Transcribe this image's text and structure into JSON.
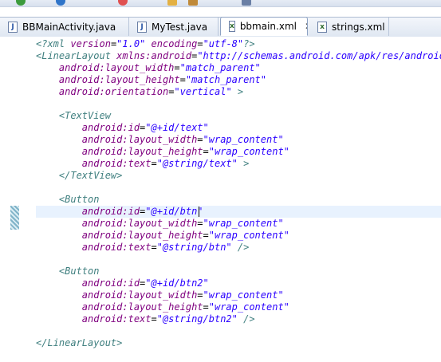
{
  "tabs": [
    {
      "label": "BBMainActivity.java",
      "icon": "java-file-icon",
      "active": false
    },
    {
      "label": "MyTest.java",
      "icon": "java-file-icon",
      "active": false
    },
    {
      "label": "bbmain.xml",
      "icon": "xml-file-icon",
      "active": true,
      "close_glyph": "✕"
    },
    {
      "label": "strings.xml",
      "icon": "xml-file-icon",
      "active": false
    }
  ],
  "editor": {
    "lines": [
      [
        [
          "decl",
          "<?xml "
        ],
        [
          "attr",
          "version"
        ],
        [
          "tx",
          "="
        ],
        [
          "val",
          "\"1.0\""
        ],
        [
          "tx",
          " "
        ],
        [
          "attr",
          "encoding"
        ],
        [
          "tx",
          "="
        ],
        [
          "val",
          "\"utf-8\""
        ],
        [
          "decl",
          "?>"
        ]
      ],
      [
        [
          "tag",
          "<LinearLayout "
        ],
        [
          "attr",
          "xmlns:android"
        ],
        [
          "tx",
          "="
        ],
        [
          "val",
          "\"http://schemas.android.com/apk/res/android\""
        ]
      ],
      [
        [
          "tx",
          "    "
        ],
        [
          "attr",
          "android:layout_width"
        ],
        [
          "tx",
          "="
        ],
        [
          "val",
          "\"match_parent\""
        ]
      ],
      [
        [
          "tx",
          "    "
        ],
        [
          "attr",
          "android:layout_height"
        ],
        [
          "tx",
          "="
        ],
        [
          "val",
          "\"match_parent\""
        ]
      ],
      [
        [
          "tx",
          "    "
        ],
        [
          "attr",
          "android:orientation"
        ],
        [
          "tx",
          "="
        ],
        [
          "val",
          "\"vertical\""
        ],
        [
          "tag",
          " >"
        ]
      ],
      [],
      [
        [
          "tx",
          "    "
        ],
        [
          "tag",
          "<TextView"
        ]
      ],
      [
        [
          "tx",
          "        "
        ],
        [
          "attr",
          "android:id"
        ],
        [
          "tx",
          "="
        ],
        [
          "val",
          "\"@+id/text\""
        ]
      ],
      [
        [
          "tx",
          "        "
        ],
        [
          "attr",
          "android:layout_width"
        ],
        [
          "tx",
          "="
        ],
        [
          "val",
          "\"wrap_content\""
        ]
      ],
      [
        [
          "tx",
          "        "
        ],
        [
          "attr",
          "android:layout_height"
        ],
        [
          "tx",
          "="
        ],
        [
          "val",
          "\"wrap_content\""
        ]
      ],
      [
        [
          "tx",
          "        "
        ],
        [
          "attr",
          "android:text"
        ],
        [
          "tx",
          "="
        ],
        [
          "val",
          "\"@string/text\""
        ],
        [
          "tag",
          " >"
        ]
      ],
      [
        [
          "tx",
          "    "
        ],
        [
          "tag",
          "</TextView>"
        ]
      ],
      [],
      [
        [
          "tx",
          "    "
        ],
        [
          "tag",
          "<Button"
        ]
      ],
      [
        [
          "tx",
          "        "
        ],
        [
          "attr",
          "android:id"
        ],
        [
          "tx",
          "="
        ],
        [
          "val",
          "\"@+id/btn\""
        ]
      ],
      [
        [
          "tx",
          "        "
        ],
        [
          "attr",
          "android:layout_width"
        ],
        [
          "tx",
          "="
        ],
        [
          "val",
          "\"wrap_content\""
        ]
      ],
      [
        [
          "tx",
          "        "
        ],
        [
          "attr",
          "android:layout_height"
        ],
        [
          "tx",
          "="
        ],
        [
          "val",
          "\"wrap_content\""
        ]
      ],
      [
        [
          "tx",
          "        "
        ],
        [
          "attr",
          "android:text"
        ],
        [
          "tx",
          "="
        ],
        [
          "val",
          "\"@string/btn\""
        ],
        [
          "tag",
          " />"
        ]
      ],
      [],
      [
        [
          "tx",
          "    "
        ],
        [
          "tag",
          "<Button"
        ]
      ],
      [
        [
          "tx",
          "        "
        ],
        [
          "attr",
          "android:id"
        ],
        [
          "tx",
          "="
        ],
        [
          "val",
          "\"@+id/btn2\""
        ]
      ],
      [
        [
          "tx",
          "        "
        ],
        [
          "attr",
          "android:layout_width"
        ],
        [
          "tx",
          "="
        ],
        [
          "val",
          "\"wrap_content\""
        ]
      ],
      [
        [
          "tx",
          "        "
        ],
        [
          "attr",
          "android:layout_height"
        ],
        [
          "tx",
          "="
        ],
        [
          "val",
          "\"wrap_content\""
        ]
      ],
      [
        [
          "tx",
          "        "
        ],
        [
          "attr",
          "android:text"
        ],
        [
          "tx",
          "="
        ],
        [
          "val",
          "\"@string/btn2\""
        ],
        [
          "tag",
          " />"
        ]
      ],
      [],
      [
        [
          "tag",
          "</LinearLayout>"
        ]
      ]
    ]
  }
}
